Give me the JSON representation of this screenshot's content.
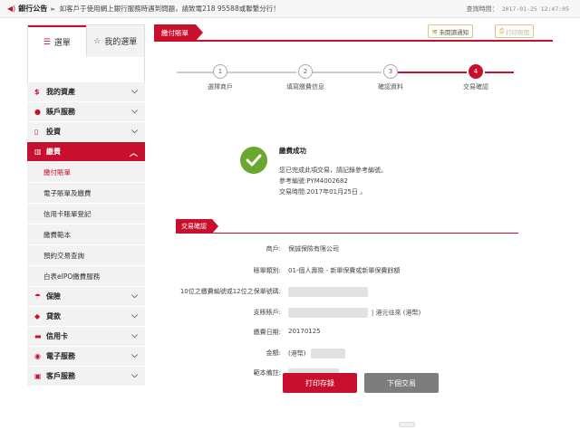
{
  "announcement": {
    "label": "銀行公告",
    "text": "如客戶于使用網上銀行服務時遇到問題，請致電218 95588或聯繫分行！",
    "time_label": "查詢時間：",
    "time_value": "2017-01-25 12:47:05"
  },
  "sidebar": {
    "tabs": [
      {
        "label": "選單",
        "icon": "list-icon"
      },
      {
        "label": "我的選單",
        "icon": "star-icon"
      }
    ],
    "menu": [
      {
        "label": "我的資產",
        "icon": "money-bag-icon",
        "open": false
      },
      {
        "label": "賬戶服務",
        "icon": "user-icon",
        "open": false
      },
      {
        "label": "投資",
        "icon": "invest-icon",
        "open": false
      },
      {
        "label": "繳費",
        "icon": "bar-chart-icon",
        "open": true,
        "children": [
          {
            "label": "繳付賬單",
            "current": true
          },
          {
            "label": "電子賬單及繳費"
          },
          {
            "label": "信用卡賬單登記"
          },
          {
            "label": "繳費範本"
          },
          {
            "label": "預約交易查詢"
          },
          {
            "label": "白表eIPO繳費服務"
          }
        ]
      },
      {
        "label": "保險",
        "icon": "umbrella-icon",
        "open": false
      },
      {
        "label": "貸款",
        "icon": "diamond-icon",
        "open": false
      },
      {
        "label": "信用卡",
        "icon": "card-icon",
        "open": false
      },
      {
        "label": "電子服務",
        "icon": "location-icon",
        "open": false
      },
      {
        "label": "客戶服務",
        "icon": "customer-icon",
        "open": false
      }
    ]
  },
  "main": {
    "tab_label": "繳付賬單",
    "unread_label": "未閱讀通知",
    "print_label": "打印頁面",
    "steps": [
      {
        "num": "1",
        "label": "選擇商戶"
      },
      {
        "num": "2",
        "label": "填寫繳費信息"
      },
      {
        "num": "3",
        "label": "確認資料"
      },
      {
        "num": "4",
        "label": "交易確認"
      }
    ],
    "success": {
      "title": "繳費成功",
      "line1": "您已完成此項交易，請記錄參考編號。",
      "line2": "參考編號:PYM4002682",
      "line3": "交易時間:2017年01月25日 。"
    },
    "section_label": "交易確認",
    "details": [
      {
        "label": "商戶:",
        "value": "保誠保險有限公司"
      },
      {
        "label": "賬單類別:",
        "value": "01-個人壽險 - 新單保費或新單保費餘額"
      },
      {
        "label": "10位之繳費編號或12位之保單號碼:",
        "value": ""
      },
      {
        "label": "支賬賬戶:",
        "value": "| 港元往來 (港幣)"
      },
      {
        "label": "繳費日期:",
        "value": "20170125"
      },
      {
        "label": "金額:",
        "value": "(港幣)"
      },
      {
        "label": "範本備註:",
        "value": ""
      }
    ],
    "buttons": {
      "print": "打印存錄",
      "next": "下個交易"
    }
  },
  "colors": {
    "brand_red": "#c8102e",
    "success_green": "#6aa82f",
    "menu_bg": "#f2f2f2"
  }
}
